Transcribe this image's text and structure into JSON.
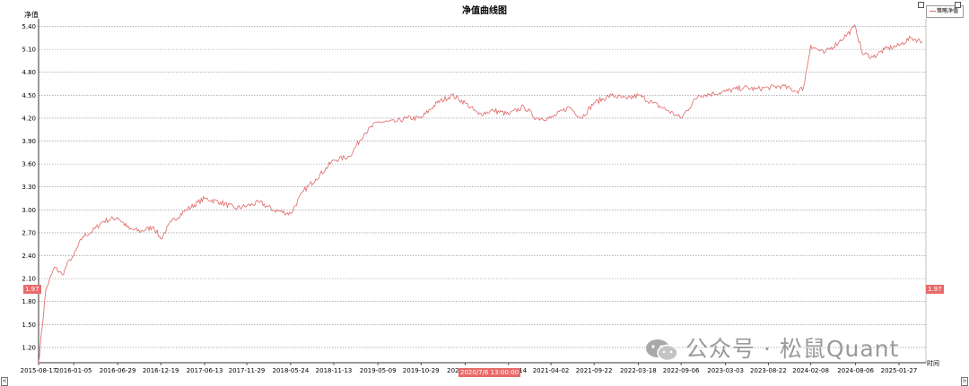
{
  "chart_data": {
    "type": "line",
    "title": "净值曲线图",
    "ylabel": "净值",
    "xlabel": "时间",
    "ylim": [
      1.0,
      5.5
    ],
    "y_ticks": [
      5.4,
      5.1,
      4.8,
      4.5,
      4.2,
      3.9,
      3.6,
      3.3,
      3.0,
      2.7,
      2.4,
      2.1,
      1.8,
      1.5,
      1.2
    ],
    "x_ticks": [
      "2015-08-17",
      "2016-01-05",
      "2016-06-29",
      "2016-12-19",
      "2017-06-13",
      "2017-11-29",
      "2018-05-24",
      "2018-11-13",
      "2019-05-09",
      "2019-10-29",
      "2020-04-23",
      "2020-10-14",
      "2021-04-02",
      "2021-09-22",
      "2022-03-18",
      "2022-09-06",
      "2023-03-03",
      "2023-08-22",
      "2024-02-08",
      "2024-08-06",
      "2025-01-27"
    ],
    "grid": true,
    "legend_position": "top-right",
    "series": [
      {
        "name": "策略净值",
        "color": "#e06666",
        "x": [
          "2015-08-17",
          "2015-09-15",
          "2015-10-20",
          "2015-11-20",
          "2015-12-20",
          "2016-01-05",
          "2016-02-10",
          "2016-03-20",
          "2016-05-01",
          "2016-06-29",
          "2016-08-15",
          "2016-10-01",
          "2016-11-20",
          "2016-12-19",
          "2017-02-01",
          "2017-04-01",
          "2017-06-13",
          "2017-08-15",
          "2017-10-15",
          "2017-11-29",
          "2018-01-20",
          "2018-03-15",
          "2018-05-24",
          "2018-07-15",
          "2018-09-01",
          "2018-11-13",
          "2019-01-15",
          "2019-03-15",
          "2019-05-09",
          "2019-07-15",
          "2019-09-01",
          "2019-10-29",
          "2020-01-01",
          "2020-03-01",
          "2020-04-23",
          "2020-06-15",
          "2020-08-15",
          "2020-10-14",
          "2020-12-15",
          "2021-02-01",
          "2021-04-02",
          "2021-06-15",
          "2021-08-01",
          "2021-09-22",
          "2021-12-01",
          "2022-02-01",
          "2022-03-18",
          "2022-05-15",
          "2022-07-15",
          "2022-09-06",
          "2022-11-15",
          "2023-01-15",
          "2023-03-03",
          "2023-05-15",
          "2023-07-01",
          "2023-08-22",
          "2023-10-15",
          "2023-12-15",
          "2024-01-10",
          "2024-02-08",
          "2024-04-01",
          "2024-06-01",
          "2024-08-06",
          "2024-09-01",
          "2024-10-15",
          "2024-12-01",
          "2025-01-27",
          "2025-03-15",
          "2025-05-01"
        ],
        "values": [
          1.0,
          1.95,
          2.25,
          2.15,
          2.35,
          2.4,
          2.65,
          2.72,
          2.85,
          2.9,
          2.75,
          2.72,
          2.78,
          2.62,
          2.85,
          3.0,
          3.15,
          3.1,
          3.02,
          3.05,
          3.1,
          3.0,
          2.95,
          3.25,
          3.4,
          3.65,
          3.7,
          4.0,
          4.15,
          4.15,
          4.2,
          4.2,
          4.4,
          4.5,
          4.4,
          4.25,
          4.3,
          4.25,
          4.35,
          4.2,
          4.2,
          4.35,
          4.2,
          4.4,
          4.5,
          4.45,
          4.5,
          4.4,
          4.3,
          4.2,
          4.5,
          4.52,
          4.55,
          4.6,
          4.58,
          4.6,
          4.62,
          4.55,
          4.6,
          5.15,
          5.05,
          5.2,
          5.4,
          5.05,
          5.0,
          5.1,
          5.15,
          5.25,
          5.2
        ]
      }
    ],
    "markers": {
      "current_value_label": "1.97",
      "crosshair_label": "2020/7/6 13:00:00"
    }
  },
  "window_controls": {
    "scroll_left": "<",
    "scroll_right": ">"
  },
  "watermark": {
    "text": "公众号 · 松鼠Quant"
  }
}
